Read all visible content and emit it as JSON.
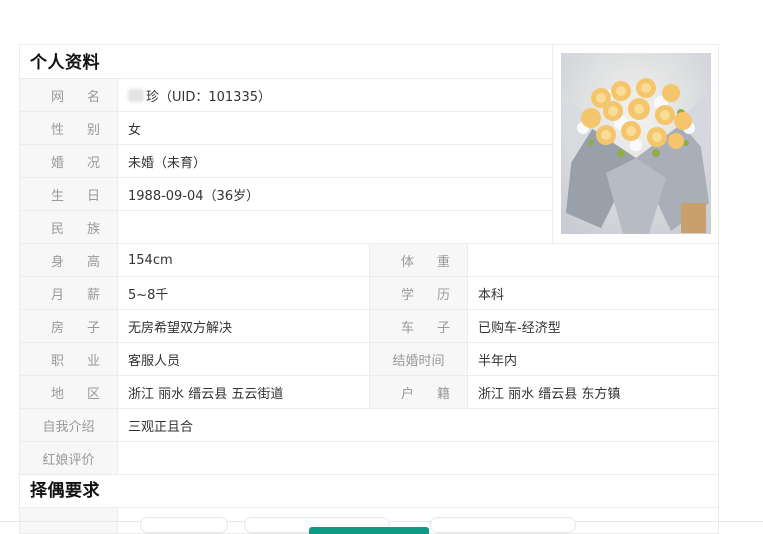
{
  "section1_title": "个人资料",
  "section2_title": "择偶要求",
  "profile": {
    "nickname": {
      "label_a": "网",
      "label_b": "名",
      "value": "珍（UID：101335）"
    },
    "gender": {
      "label_a": "性",
      "label_b": "别",
      "value": "女"
    },
    "marriage": {
      "label_a": "婚",
      "label_b": "况",
      "value": "未婚（未育）"
    },
    "birthday": {
      "label_a": "生",
      "label_b": "日",
      "value": "1988-09-04（36岁）"
    },
    "ethnicity": {
      "label_a": "民",
      "label_b": "族",
      "value": ""
    }
  },
  "details": [
    {
      "l1a": "身",
      "l1b": "高",
      "v1": "154cm",
      "l2a": "体",
      "l2b": "重",
      "v2": ""
    },
    {
      "l1a": "月",
      "l1b": "薪",
      "v1": "5~8千",
      "l2a": "学",
      "l2b": "历",
      "v2": "本科"
    },
    {
      "l1a": "房",
      "l1b": "子",
      "v1": "无房希望双方解决",
      "l2a": "车",
      "l2b": "子",
      "v2": "已购车-经济型"
    },
    {
      "l1a": "职",
      "l1b": "业",
      "v1": "客服人员",
      "l2": "结婚时间",
      "v2": "半年内"
    },
    {
      "l1a": "地",
      "l1b": "区",
      "v1": "浙江 丽水 缙云县 五云街道",
      "l2a": "户",
      "l2b": "籍",
      "v2": "浙江 丽水 缙云县 东方镇"
    }
  ],
  "intro": {
    "label": "自我介绍",
    "value": "三观正且合"
  },
  "matchmaker": {
    "label": "红娘评价",
    "value": ""
  }
}
